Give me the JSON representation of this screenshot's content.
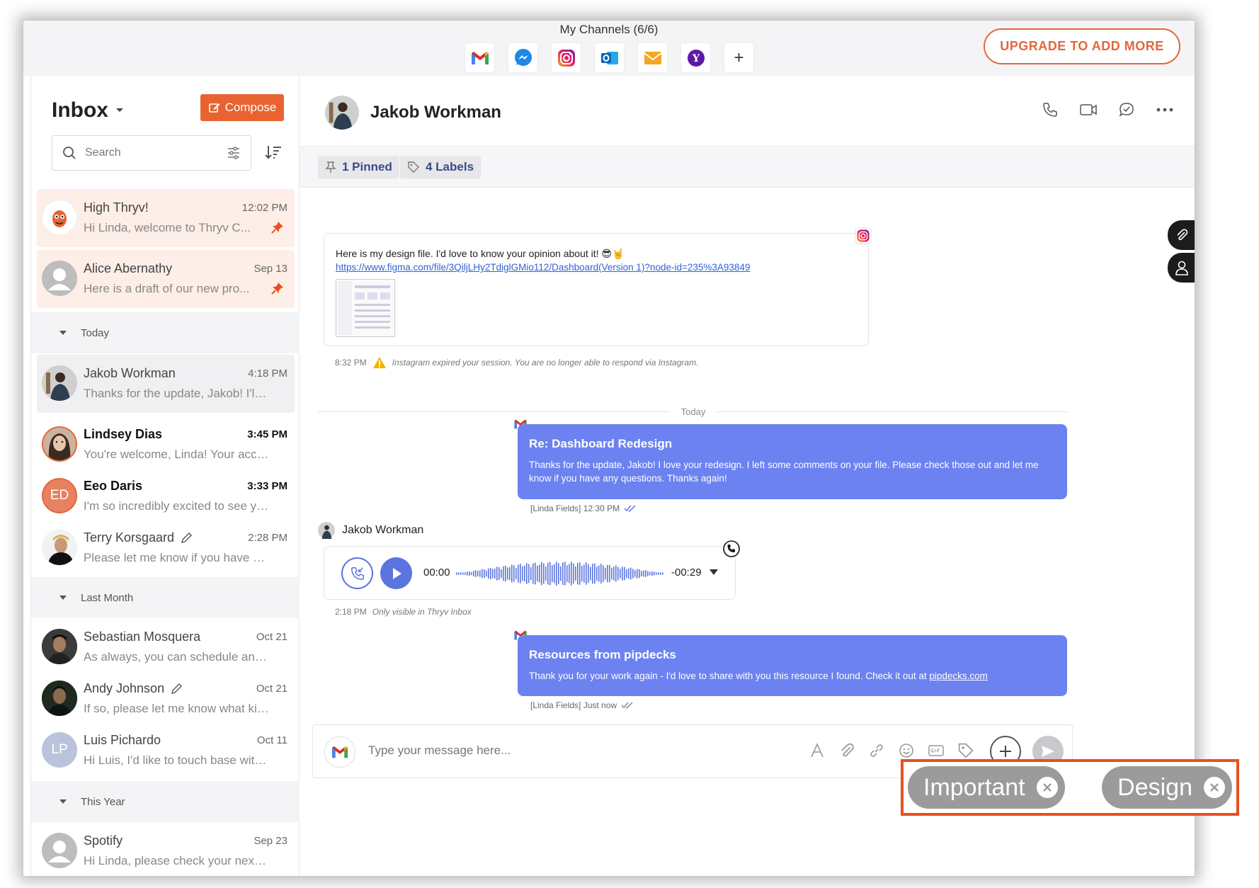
{
  "topbar": {
    "channels_title": "My Channels (6/6)",
    "channels": [
      "gmail-icon",
      "messenger-icon",
      "instagram-icon",
      "outlook-icon",
      "email-icon",
      "yahoo-icon",
      "add-channel-icon"
    ],
    "add_symbol": "+",
    "upgrade_label": "UPGRADE TO ADD MORE"
  },
  "sidebar": {
    "title": "Inbox",
    "compose_label": "Compose",
    "search_placeholder": "Search",
    "pinned": [
      {
        "name": "High Thryv!",
        "time": "12:02 PM",
        "preview": "Hi Linda, welcome to Thryv C..."
      },
      {
        "name": "Alice Abernathy",
        "time": "Sep 13",
        "preview": "Here is a draft of our new pro..."
      }
    ],
    "sections": [
      {
        "title": "Today",
        "items": [
          {
            "name": "Jakob Workman",
            "time": "4:18 PM",
            "preview": "Thanks for the update, Jakob! I'll let ..."
          },
          {
            "name": "Lindsey Dias",
            "time": "3:45 PM",
            "preview": "You're welcome, Linda! Your accou..."
          },
          {
            "name": "Eeo Daris",
            "time": "3:33 PM",
            "preview": "I'm so incredibly excited to see you ...",
            "initials": "ED"
          },
          {
            "name": "Terry Korsgaard",
            "time": "2:28 PM",
            "preview": "Please let me know if you have any ..."
          }
        ]
      },
      {
        "title": "Last Month",
        "items": [
          {
            "name": "Sebastian Mosquera",
            "time": "Oct 21",
            "preview": "As always, you can schedule an app..."
          },
          {
            "name": "Andy Johnson",
            "time": "Oct 21",
            "preview": "If so, please let me know what kind ..."
          },
          {
            "name": "Luis Pichardo",
            "time": "Oct 11",
            "preview": "Hi Luis, I'd like to touch base with y...",
            "initials": "LP"
          }
        ]
      },
      {
        "title": "This Year",
        "items": [
          {
            "name": "Spotify",
            "time": "Sep 23",
            "preview": "Hi Linda, please check your next m..."
          }
        ]
      }
    ]
  },
  "conversation": {
    "contact_name": "Jakob Workman",
    "pinned_label": "1 Pinned",
    "labels_label": "4 Labels",
    "instagram_message": {
      "text": "Here is my design file. I'd love to know your opinion about it! 😎🤘",
      "link": "https://www.figma.com/file/3QiljLHy2TdiglGMio112/Dashboard(Version 1)?node-id=235%3A93849",
      "time": "8:32 PM",
      "warning": "Instagram expired your session. You are no longer able to respond via Instagram."
    },
    "divider": "Today",
    "email1": {
      "subject": "Re: Dashboard Redesign",
      "body": "Thanks for the update, Jakob! I love your redesign. I left some comments on your file. Please check those out and let me know if you have any questions. Thanks again!",
      "meta": "[Linda Fields] 12:30 PM"
    },
    "voice": {
      "sender": "Jakob Workman",
      "start": "00:00",
      "end": "-00:29",
      "time": "2:18 PM",
      "note": "Only visible in Thryv Inbox"
    },
    "email2": {
      "subject": "Resources from pipdecks",
      "body_prefix": "Thank you for your work again - I'd love to share with you this resource I found. Check it out at ",
      "body_link": "pipdecks.com",
      "meta": "[Linda Fields] Just now"
    },
    "composer_placeholder": "Type your message here..."
  },
  "labels_overlay": [
    "Important",
    "Design"
  ],
  "colors": {
    "accent_orange": "#e8632f",
    "email_bubble": "#6b82f0",
    "voice_blue": "#5c74e0"
  }
}
